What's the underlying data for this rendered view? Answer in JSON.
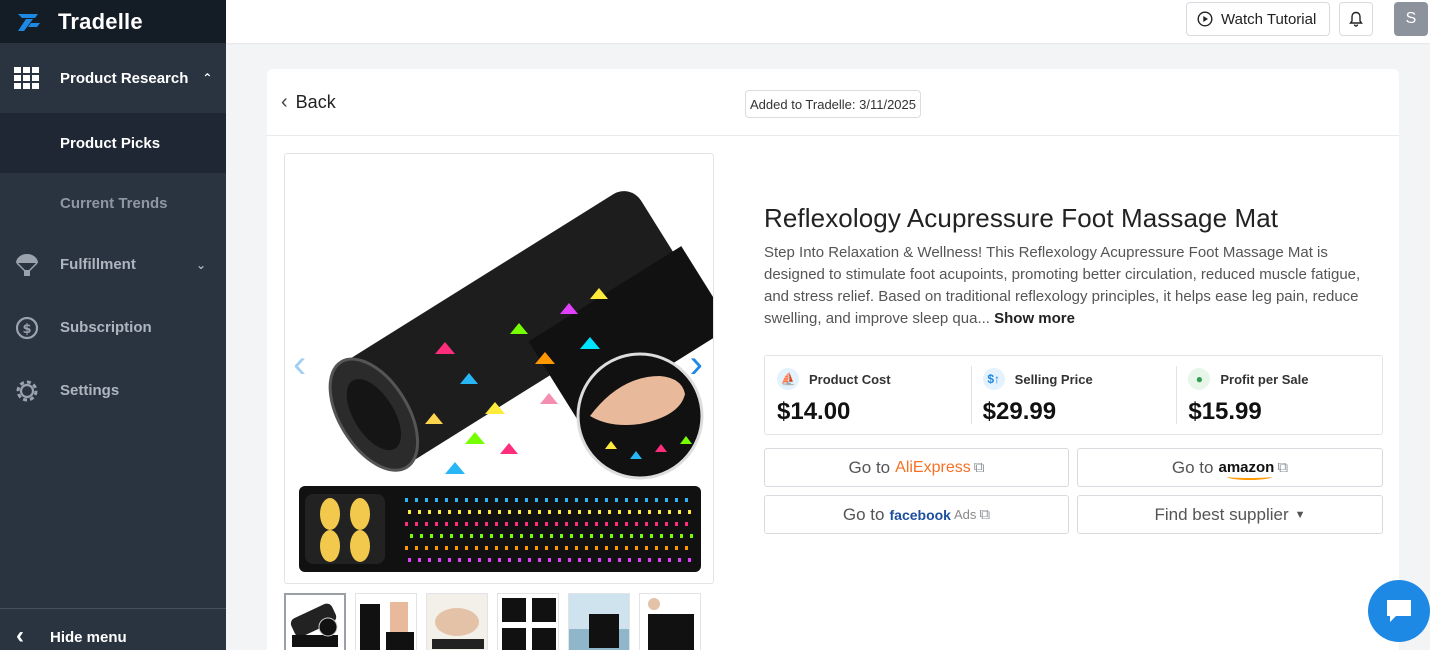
{
  "app": {
    "name": "Tradelle"
  },
  "sidebar": {
    "items": [
      {
        "label": "Product Research",
        "icon": "grid-icon",
        "expanded": true
      },
      {
        "label": "Product Picks",
        "active": true
      },
      {
        "label": "Current Trends"
      },
      {
        "label": "Fulfillment",
        "icon": "parachute-icon"
      },
      {
        "label": "Subscription",
        "icon": "dollar-refresh-icon"
      },
      {
        "label": "Settings",
        "icon": "gear-icon"
      }
    ],
    "hide_menu": "Hide menu"
  },
  "topbar": {
    "watch_tutorial": "Watch Tutorial",
    "avatar_initial": "S"
  },
  "product": {
    "back_label": "Back",
    "added": "Added to Tradelle: 3/11/2025",
    "title": "Reflexology Acupressure Foot Massage Mat",
    "description": "Step Into Relaxation & Wellness! This Reflexology Acupressure Foot Massage Mat is designed to stimulate foot acupoints, promoting better circulation, reduced muscle fatigue, and stress relief. Based on traditional reflexology principles, it helps ease leg pain, reduce swelling, and improve sleep qua...",
    "show_more": "Show more",
    "stats": [
      {
        "label": "Product Cost",
        "value": "$14.00",
        "icon": "ship-icon",
        "color": "#1e88e5"
      },
      {
        "label": "Selling Price",
        "value": "$29.99",
        "icon": "price-up-icon",
        "color": "#1e88e5"
      },
      {
        "label": "Profit per Sale",
        "value": "$15.99",
        "icon": "money-bag-icon",
        "color": "#2e9e4f"
      }
    ],
    "links": {
      "go_to": "Go to",
      "aliexpress_a": "Ali",
      "aliexpress_b": "Express",
      "amazon": "amazon",
      "facebook": "facebook",
      "facebook_ads": "Ads",
      "find_supplier": "Find best supplier"
    }
  },
  "colors": {
    "sidebar_bg": "#2a3441",
    "accent": "#1e88e5",
    "aliexpress": "#f57224",
    "amazon_smile": "#ff9900"
  }
}
